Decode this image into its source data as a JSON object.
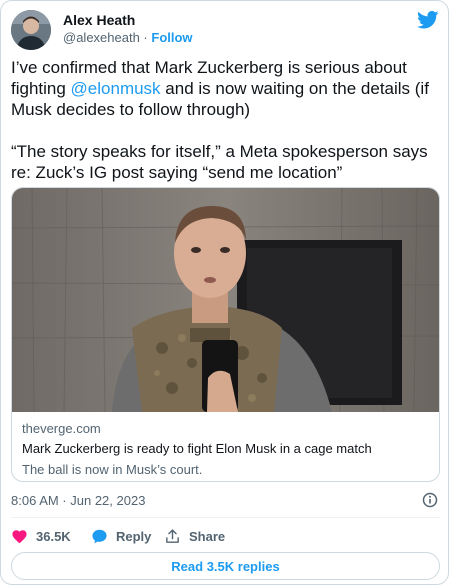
{
  "author": {
    "name": "Alex Heath",
    "handle": "@alexeheath",
    "separator": " · ",
    "follow_label": "Follow"
  },
  "tweet": {
    "para1_before": "I’ve confirmed that Mark Zuckerberg is serious about fighting ",
    "mention": "@elonmusk",
    "para1_after": " and is now waiting on the details (if Musk decides to follow through)",
    "para2": "“The story speaks for itself,” a Meta spokesperson says re: Zuck’s IG post saying “send me location”"
  },
  "link_card": {
    "domain": "theverge.com",
    "title": "Mark Zuckerberg is ready to fight Elon Musk in a cage match",
    "description": "The ball is now in Musk’s court."
  },
  "timestamp": "8:06 AM · Jun 22, 2023",
  "actions": {
    "like_count": "36.5K",
    "reply_label": "Reply",
    "share_label": "Share"
  },
  "read_replies_label": "Read 3.5K replies",
  "colors": {
    "accent": "#1d9bf0",
    "like": "#f91880",
    "text": "#0f1419",
    "secondary": "#536471"
  },
  "icons": [
    "twitter-bird-icon",
    "info-icon",
    "heart-icon",
    "reply-bubble-icon",
    "share-icon"
  ]
}
